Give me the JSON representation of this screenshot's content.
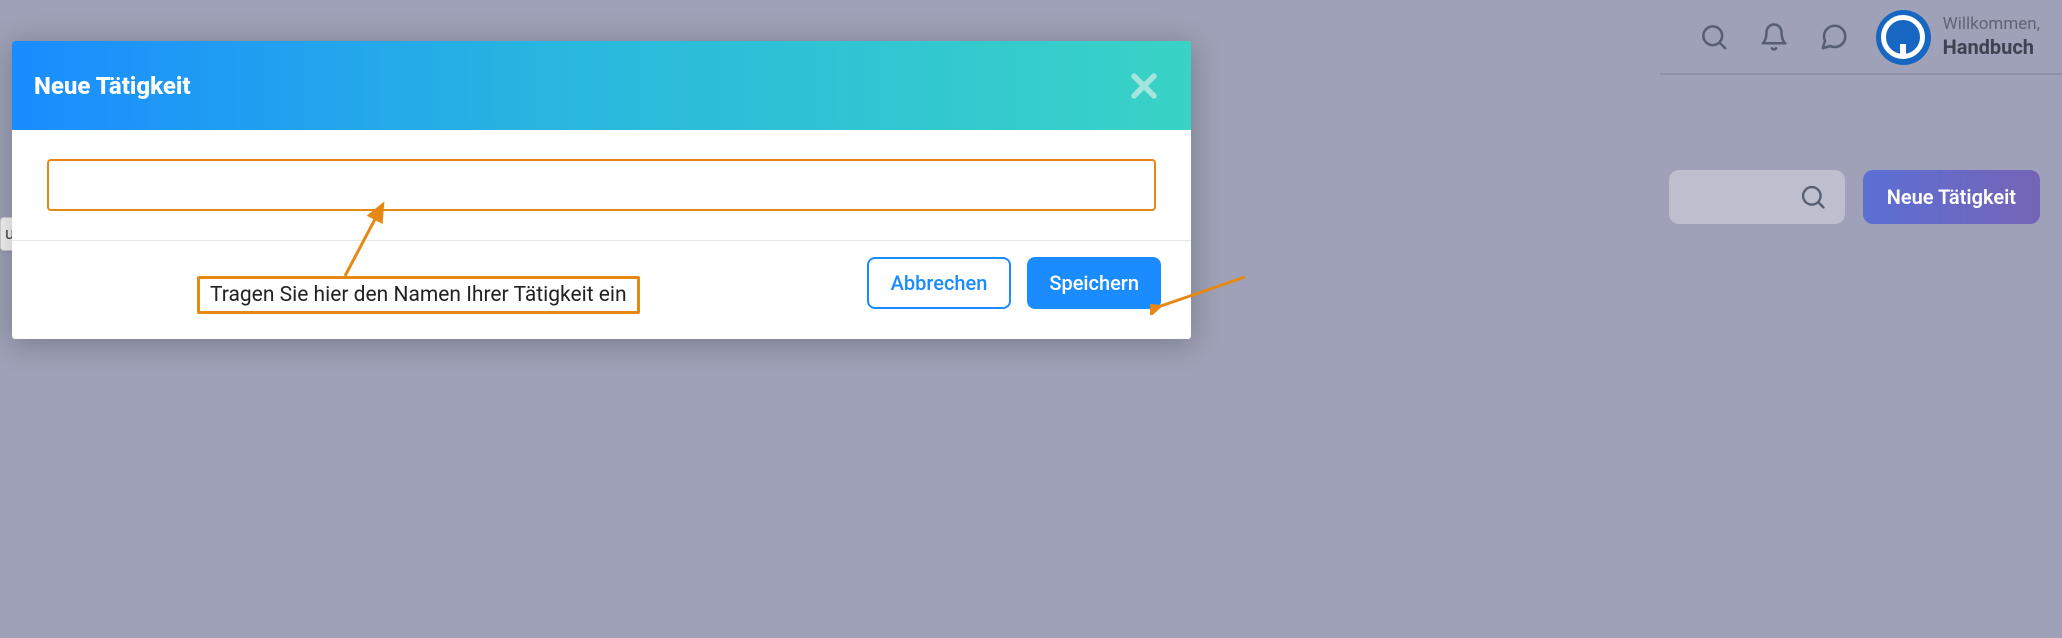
{
  "topbar": {
    "welcome_small": "Willkommen,",
    "welcome_name": "Handbuch",
    "icons": {
      "search": "search-icon",
      "bell": "bell-icon",
      "chat": "chat-icon"
    }
  },
  "secondary": {
    "new_activity_label": "Neue Tätigkeit"
  },
  "cropped_chip": "ung",
  "modal": {
    "title": "Neue Tätigkeit",
    "input_value": "",
    "cancel_label": "Abbrechen",
    "save_label": "Speichern"
  },
  "annotation": {
    "callout_text": "Tragen Sie hier den Namen Ihrer Tätigkeit ein"
  },
  "colors": {
    "accent_orange": "#e78815",
    "primary_blue": "#1a8cff"
  }
}
